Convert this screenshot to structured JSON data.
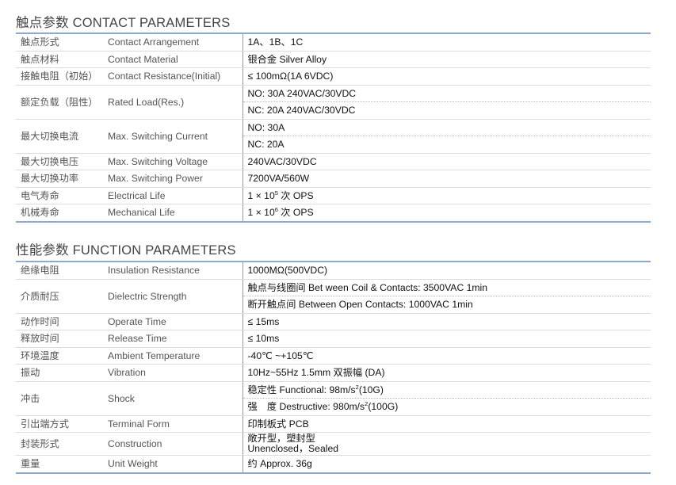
{
  "contact": {
    "title": "触点参数 CONTACT PARAMETERS",
    "rows": [
      {
        "zh": "触点形式",
        "en": "Contact Arrangement",
        "values": [
          "1A、1B、1C"
        ]
      },
      {
        "zh": "触点材料",
        "en": "Contact Material",
        "values": [
          "银合金 Silver Alloy"
        ]
      },
      {
        "zh": "接触电阻（初始）",
        "en": "Contact Resistance(Initial)",
        "values": [
          "≤ 100mΩ(1A 6VDC)"
        ]
      },
      {
        "zh": "额定负载（阻性）",
        "en": "Rated Load(Res.)",
        "values": [
          "NO: 30A 240VAC/30VDC",
          "NC: 20A 240VAC/30VDC"
        ]
      },
      {
        "zh": "最大切换电流",
        "en": "Max. Switching Current",
        "values": [
          "NO: 30A",
          "NC: 20A"
        ]
      },
      {
        "zh": "最大切换电压",
        "en": "Max. Switching Voltage",
        "values": [
          "240VAC/30VDC"
        ]
      },
      {
        "zh": "最大切换功率",
        "en": "Max. Switching Power",
        "values": [
          "7200VA/560W"
        ]
      },
      {
        "zh": "电气寿命",
        "en": "Electrical Life",
        "values": [
          {
            "pre": "1 × 10",
            "sup": "5",
            "post": " 次 OPS"
          }
        ]
      },
      {
        "zh": "机械寿命",
        "en": "Mechanical Life",
        "values": [
          {
            "pre": "1 × 10",
            "sup": "6",
            "post": " 次 OPS"
          }
        ]
      }
    ]
  },
  "function": {
    "title": "性能参数 FUNCTION PARAMETERS",
    "rows": [
      {
        "zh": "绝缘电阻",
        "en": "Insulation Resistance",
        "values": [
          "1000MΩ(500VDC)"
        ]
      },
      {
        "zh": "介质耐压",
        "en": "Dielectric Strength",
        "values": [
          "触点与线圈间 Bet ween Coil & Contacts: 3500VAC 1min",
          "断开触点间 Between Open Contacts: 1000VAC 1min"
        ]
      },
      {
        "zh": "动作时间",
        "en": "Operate Time",
        "values": [
          "≤ 15ms"
        ]
      },
      {
        "zh": "释放时间",
        "en": "Release Time",
        "values": [
          "≤ 10ms"
        ]
      },
      {
        "zh": "环境温度",
        "en": "Ambient Temperature",
        "values": [
          "-40℃ ~+105℃"
        ]
      },
      {
        "zh": "振动",
        "en": "Vibration",
        "values": [
          "10Hz~55Hz 1.5mm 双振幅 (DA)"
        ]
      },
      {
        "zh": "冲击",
        "en": "Shock",
        "values": [
          {
            "pre": "稳定性 Functional: 98m/s",
            "sup": "2",
            "post": "(10G)"
          },
          {
            "pre": "强　度 Destructive: 980m/s",
            "sup": "2",
            "post": "(100G)"
          }
        ]
      },
      {
        "zh": "引出端方式",
        "en": "Terminal Form",
        "values": [
          "印制板式 PCB"
        ]
      },
      {
        "zh": "封装形式",
        "en": "Construction",
        "values": [
          {
            "lines": [
              "敞开型，塑封型",
              "Unenclosed，Sealed"
            ]
          }
        ]
      },
      {
        "zh": "重量",
        "en": "Unit Weight",
        "values": [
          "约 Approx. 36g"
        ]
      }
    ]
  }
}
